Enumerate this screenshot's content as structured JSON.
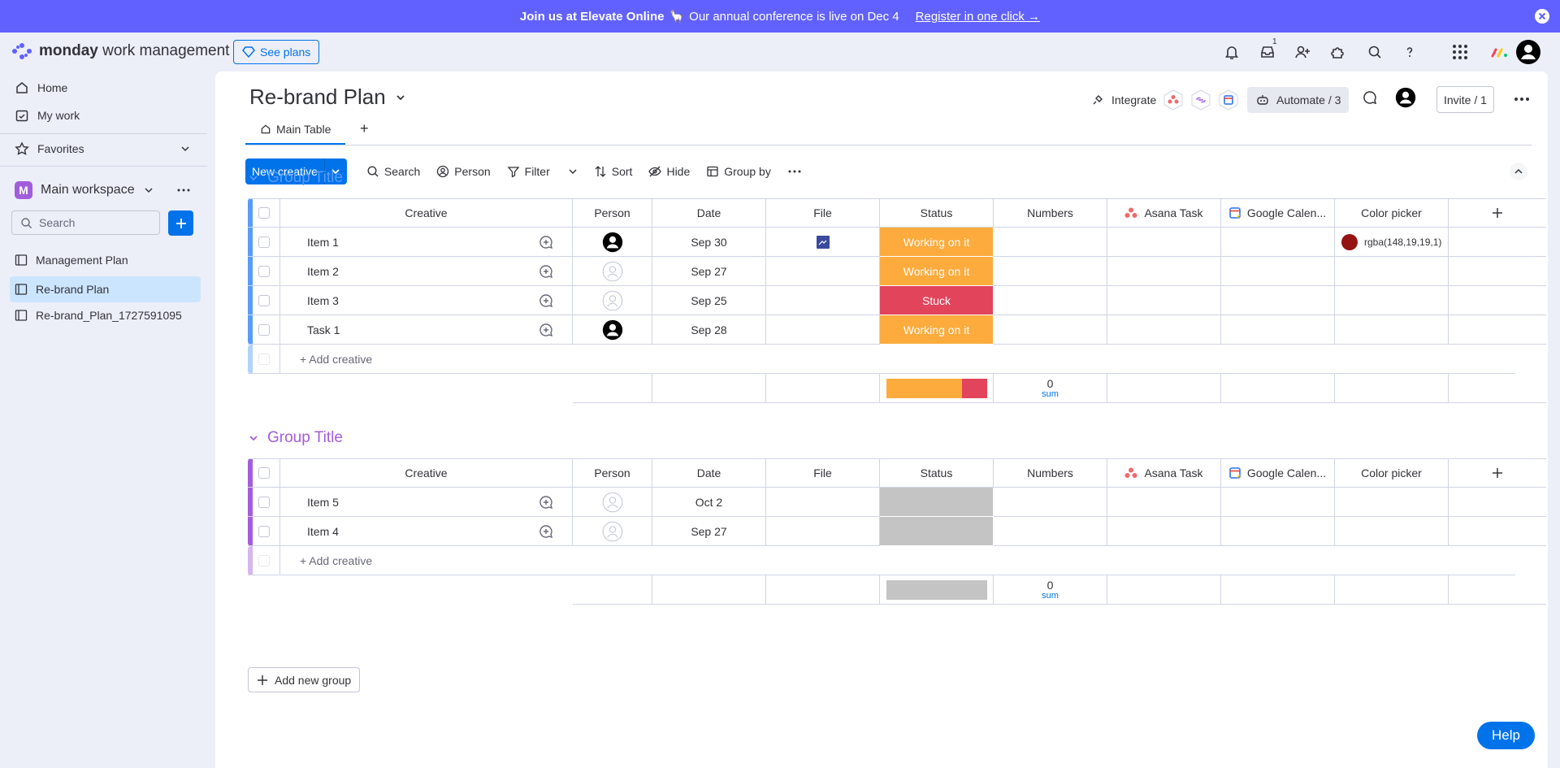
{
  "banner": {
    "strong": "Join us at Elevate Online",
    "emoji": "🦙",
    "text": "Our annual conference is live on Dec 4",
    "link": "Register in one click →"
  },
  "topbar": {
    "logo_word": "monday",
    "logo_suffix": "work management",
    "see_plans": "See plans",
    "inbox_badge": "1"
  },
  "sidebar": {
    "home": "Home",
    "my_work": "My work",
    "favorites": "Favorites",
    "workspace_letter": "M",
    "workspace": "Main workspace",
    "search_placeholder": "Search",
    "boards": [
      "Management Plan",
      "Re-brand Plan",
      "Re-brand_Plan_1727591095"
    ]
  },
  "board": {
    "title": "Re-brand Plan",
    "tab_main": "Main Table",
    "tab_add": "+",
    "integrate": "Integrate",
    "automate": "Automate / 3",
    "invite": "Invite / 1"
  },
  "toolbar": {
    "new_item": "New creative",
    "search": "Search",
    "person": "Person",
    "filter": "Filter",
    "sort": "Sort",
    "hide": "Hide",
    "group_by": "Group by"
  },
  "columns": [
    "Creative",
    "Person",
    "Date",
    "File",
    "Status",
    "Numbers",
    "Asana Task",
    "Google Calen...",
    "Color picker"
  ],
  "colors": {
    "working": "#fdab3d",
    "stuck": "#e2445c",
    "empty_status": "#c4c4c4",
    "group1": "#579bfc",
    "group2": "#a25ddc",
    "color_picker_value": "#941313"
  },
  "groups": [
    {
      "title": "Group Title",
      "rows": [
        {
          "name": "Item 1",
          "person": "filled",
          "date": "Sep 30",
          "file": true,
          "status": "Working on it",
          "color": "rgba(148,19,19,1)"
        },
        {
          "name": "Item 2",
          "person": "empty",
          "date": "Sep 27",
          "file": false,
          "status": "Working on it",
          "color": ""
        },
        {
          "name": "Item 3",
          "person": "empty",
          "date": "Sep 25",
          "file": false,
          "status": "Stuck",
          "color": ""
        },
        {
          "name": "Task 1",
          "person": "filled",
          "date": "Sep 28",
          "file": false,
          "status": "Working on it",
          "color": ""
        }
      ],
      "add_item": "+ Add creative",
      "sum_value": "0",
      "sum_label": "sum",
      "status_summary": {
        "working": 3,
        "stuck": 1
      }
    },
    {
      "title": "Group Title",
      "rows": [
        {
          "name": "Item 5",
          "person": "empty",
          "date": "Oct 2",
          "file": false,
          "status": "",
          "color": ""
        },
        {
          "name": "Item 4",
          "person": "empty",
          "date": "Sep 27",
          "file": false,
          "status": "",
          "color": ""
        }
      ],
      "add_item": "+ Add creative",
      "sum_value": "0",
      "sum_label": "sum",
      "status_summary": {
        "empty": 2
      }
    }
  ],
  "add_group": "Add new group",
  "help": "Help"
}
